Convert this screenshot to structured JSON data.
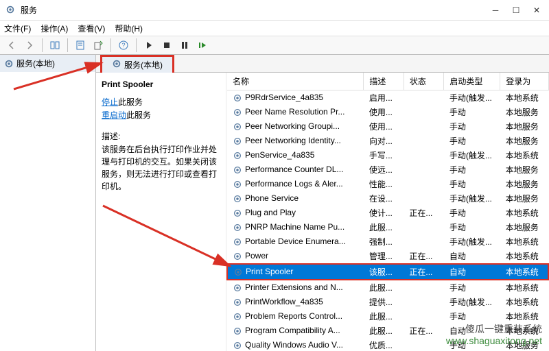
{
  "window": {
    "title": "服务"
  },
  "menu": {
    "file": "文件(F)",
    "action": "操作(A)",
    "view": "查看(V)",
    "help": "帮助(H)"
  },
  "nav": {
    "header": "服务(本地)"
  },
  "tab": {
    "label": "服务(本地)"
  },
  "detail": {
    "service_name": "Print Spooler",
    "stop_link": "停止",
    "stop_suffix": "此服务",
    "restart_link": "重启动",
    "restart_suffix": "此服务",
    "desc_label": "描述:",
    "desc_text": "该服务在后台执行打印作业并处理与打印机的交互。如果关闭该服务，则无法进行打印或查看打印机。"
  },
  "columns": {
    "name": "名称",
    "desc": "描述",
    "status": "状态",
    "startup": "启动类型",
    "logon": "登录为"
  },
  "rows": [
    {
      "name": "P9RdrService_4a835",
      "desc": "启用...",
      "status": "",
      "startup": "手动(触发...",
      "logon": "本地系统"
    },
    {
      "name": "Peer Name Resolution Pr...",
      "desc": "使用...",
      "status": "",
      "startup": "手动",
      "logon": "本地服务"
    },
    {
      "name": "Peer Networking Groupi...",
      "desc": "使用...",
      "status": "",
      "startup": "手动",
      "logon": "本地服务"
    },
    {
      "name": "Peer Networking Identity...",
      "desc": "向对...",
      "status": "",
      "startup": "手动",
      "logon": "本地服务"
    },
    {
      "name": "PenService_4a835",
      "desc": "手写...",
      "status": "",
      "startup": "手动(触发...",
      "logon": "本地系统"
    },
    {
      "name": "Performance Counter DL...",
      "desc": "使远...",
      "status": "",
      "startup": "手动",
      "logon": "本地服务"
    },
    {
      "name": "Performance Logs & Aler...",
      "desc": "性能...",
      "status": "",
      "startup": "手动",
      "logon": "本地服务"
    },
    {
      "name": "Phone Service",
      "desc": "在设...",
      "status": "",
      "startup": "手动(触发...",
      "logon": "本地服务"
    },
    {
      "name": "Plug and Play",
      "desc": "使计...",
      "status": "正在...",
      "startup": "手动",
      "logon": "本地系统"
    },
    {
      "name": "PNRP Machine Name Pu...",
      "desc": "此服...",
      "status": "",
      "startup": "手动",
      "logon": "本地服务"
    },
    {
      "name": "Portable Device Enumera...",
      "desc": "强制...",
      "status": "",
      "startup": "手动(触发...",
      "logon": "本地系统"
    },
    {
      "name": "Power",
      "desc": "管理...",
      "status": "正在...",
      "startup": "自动",
      "logon": "本地系统"
    },
    {
      "name": "Print Spooler",
      "desc": "该服...",
      "status": "正在...",
      "startup": "自动",
      "logon": "本地系统",
      "selected": true
    },
    {
      "name": "Printer Extensions and N...",
      "desc": "此服...",
      "status": "",
      "startup": "手动",
      "logon": "本地系统"
    },
    {
      "name": "PrintWorkflow_4a835",
      "desc": "提供...",
      "status": "",
      "startup": "手动(触发...",
      "logon": "本地系统"
    },
    {
      "name": "Problem Reports Control...",
      "desc": "此服...",
      "status": "",
      "startup": "手动",
      "logon": "本地系统"
    },
    {
      "name": "Program Compatibility A...",
      "desc": "此服...",
      "status": "正在...",
      "startup": "自动",
      "logon": "本地系统"
    },
    {
      "name": "Quality Windows Audio V...",
      "desc": "优质...",
      "status": "",
      "startup": "手动",
      "logon": "本地服务"
    }
  ],
  "watermark": {
    "line1": "傻瓜一键重装系统",
    "line2": "www.shaguaxitong.net"
  }
}
